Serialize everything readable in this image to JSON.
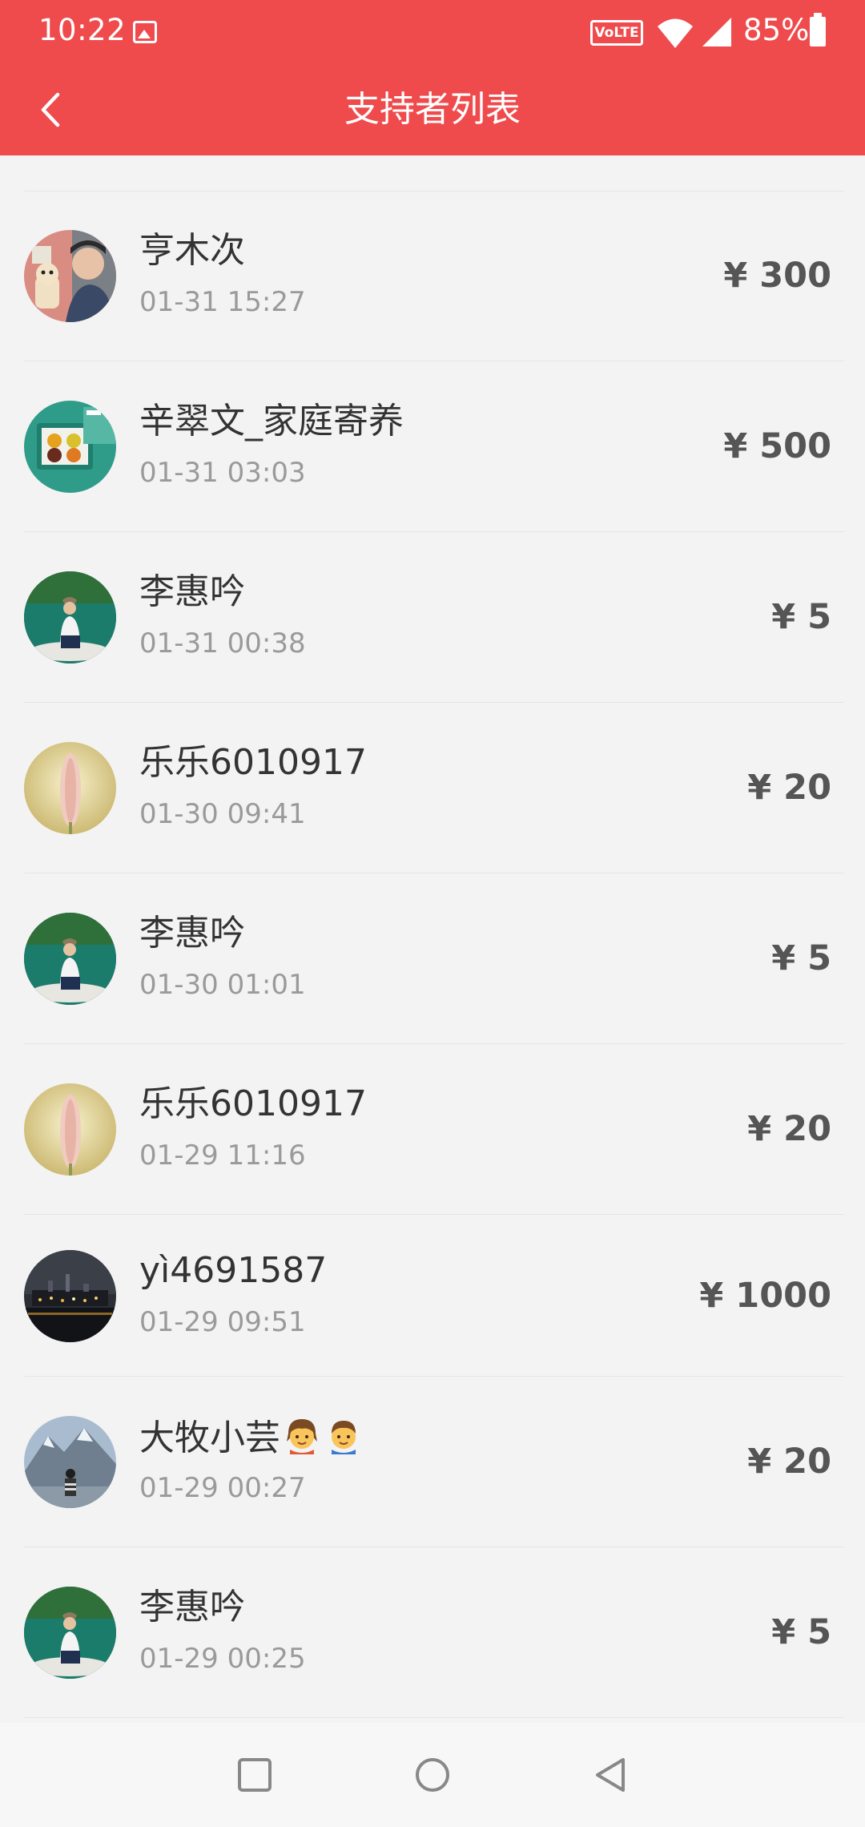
{
  "status_bar": {
    "time": "10:22",
    "volte": "VoLTE",
    "battery": "85%"
  },
  "header": {
    "title": "支持者列表"
  },
  "colors": {
    "accent": "#ef4b4d",
    "background": "#f3f3f3",
    "amount": "#555555",
    "time_text": "#9a9a9a"
  },
  "supporters": [
    {
      "name": "亨木次",
      "time": "01-31 15:27",
      "amount": "¥ 300",
      "avatar": "avatar-photo-person-with-cat"
    },
    {
      "name": "辛翠文_家庭寄养",
      "time": "01-31 03:03",
      "amount": "¥ 500",
      "avatar": "avatar-photo-gift-box"
    },
    {
      "name": "李惠吟",
      "time": "01-31 00:38",
      "amount": "¥ 5",
      "avatar": "avatar-photo-lake-woman"
    },
    {
      "name": "乐乐6010917",
      "time": "01-30 09:41",
      "amount": "¥ 20",
      "avatar": "avatar-photo-flower"
    },
    {
      "name": "李惠吟",
      "time": "01-30 01:01",
      "amount": "¥ 5",
      "avatar": "avatar-photo-lake-woman"
    },
    {
      "name": "乐乐6010917",
      "time": "01-29 11:16",
      "amount": "¥ 20",
      "avatar": "avatar-photo-flower"
    },
    {
      "name": "yì4691587",
      "time": "01-29 09:51",
      "amount": "¥ 1000",
      "avatar": "avatar-photo-night-city"
    },
    {
      "name": "大牧小芸",
      "time": "01-29 00:27",
      "amount": "¥ 20",
      "avatar": "avatar-photo-mountain",
      "emojis": [
        "girl-emoji",
        "boy-emoji"
      ]
    },
    {
      "name": "李惠吟",
      "time": "01-29 00:25",
      "amount": "¥ 5",
      "avatar": "avatar-photo-lake-woman"
    }
  ],
  "nav": {
    "icons": [
      "square-recents-icon",
      "circle-home-icon",
      "triangle-back-icon"
    ]
  }
}
